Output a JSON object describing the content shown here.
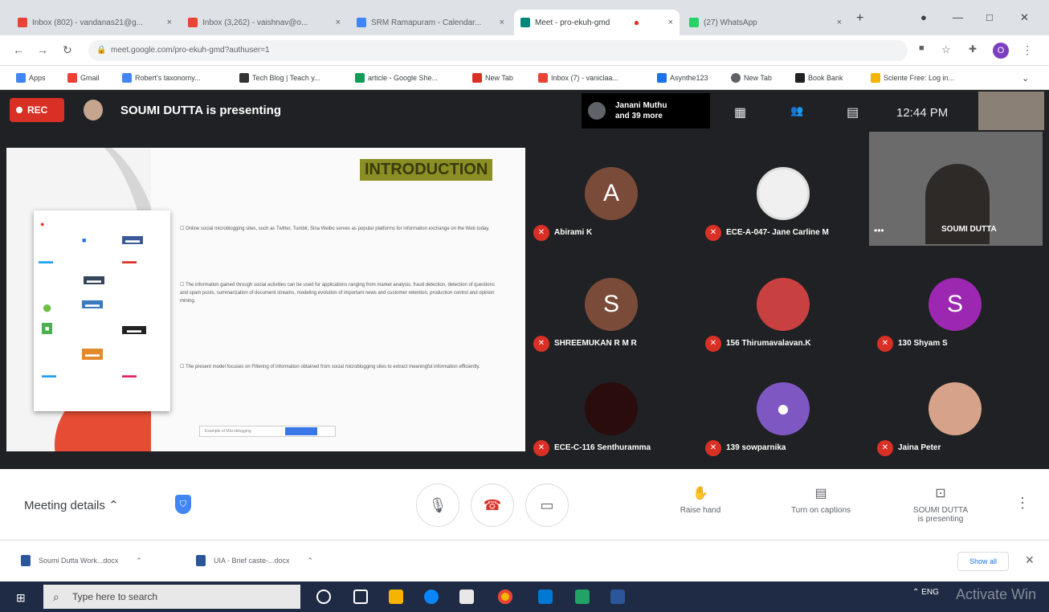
{
  "browser": {
    "tabs": [
      {
        "label": "Inbox (802) - vandanas21@g...",
        "color": "#ea4335"
      },
      {
        "label": "Inbox (3,262) - vaishnav@o...",
        "color": "#ea4335"
      },
      {
        "label": "SRM Ramapuram - Calendar...",
        "color": "#4285f4"
      },
      {
        "label": "Meet - pro-ekuh-gmd",
        "color": "#00897b"
      },
      {
        "label": "(27) WhatsApp",
        "color": "#25d366"
      }
    ],
    "new_tab": "+",
    "address": "meet.google.com/pro-ekuh-gmd?authuser=1",
    "profile_initial": "O",
    "bookmarks": [
      {
        "label": "Apps",
        "color": "#4285f4"
      },
      {
        "label": "Gmail",
        "color": "#ea4335"
      },
      {
        "label": "Robert's taxonomy...",
        "color": "#4285f4"
      },
      {
        "label": "Tech Blog | Teach y...",
        "color": "#333333"
      },
      {
        "label": "article - Google She...",
        "color": "#0f9d58"
      },
      {
        "label": "New Tab",
        "color": "#d93025"
      },
      {
        "label": "Inbox (7) - vaniclaa...",
        "color": "#ea4335"
      },
      {
        "label": "Asynthe123",
        "color": "#1a73e8"
      },
      {
        "label": "New Tab",
        "color": "#5f6368"
      },
      {
        "label": "Book Bank",
        "color": "#202124"
      },
      {
        "label": "Sciente Free: Log in...",
        "color": "#f4b400"
      }
    ]
  },
  "meet": {
    "rec_label": "REC",
    "presenter_text": "SOUMI DUTTA is presenting",
    "janani_line1": "Janani Muthu",
    "janani_line2": "and 39 more",
    "time": "12:44 PM",
    "slide": {
      "title": "INTRODUCTION",
      "bullet1": "Online social microblogging sites, such as Twitter, Tumblr, Sina Weibo serves as popular platforms for information exchange on the Web today.",
      "bullet2": "The information gained through social activities can be used for applications ranging from market analysis, fraud detection, detection of questions and spam posts, summarization of document streams, modeling evolution of important news and customer retention, production control and opinion mining.",
      "bullet3": "The present model focuses on Filtering of information obtained from social microblogging sites to extract meaningful information efficiently.",
      "bar_text": "Example of Microblogging"
    },
    "participants": [
      {
        "name": "Abirami K",
        "initial": "A",
        "color": "#7b4b3a"
      },
      {
        "name": "ECE-A-047- Jane Carline M",
        "initial": "",
        "color": "#f0f0f0"
      },
      {
        "name": "SOUMI DUTTA",
        "initial": "",
        "color": "#5a5a5a"
      },
      {
        "name": "SHREEMUKAN R M R",
        "initial": "S",
        "color": "#7b4b3a"
      },
      {
        "name": "156 Thirumavalavan.K",
        "initial": "",
        "color": "#c94040"
      },
      {
        "name": "130 Shyam S",
        "initial": "S",
        "color": "#9c27b0"
      },
      {
        "name": "ECE-C-116 Senthuramma",
        "initial": "",
        "color": "#3a1010"
      },
      {
        "name": "139 sowparnika",
        "initial": "",
        "color": "#7e57c2"
      },
      {
        "name": "Jaina Peter",
        "initial": "",
        "color": "#d6a38a"
      }
    ],
    "meeting_details": "Meeting details",
    "raise_hand": "Raise hand",
    "captions": "Turn on captions",
    "presenting_ctl_1": "SOUMI DUTTA",
    "presenting_ctl_2": "is presenting"
  },
  "downloads": {
    "items": [
      "Soumi Dutta Work...docx",
      "UIA - Brief caste-...docx"
    ],
    "show_all": "Show all"
  },
  "taskbar": {
    "search_placeholder": "Type here to search",
    "tray_text": "ENG",
    "watermark": "Activate Win"
  }
}
